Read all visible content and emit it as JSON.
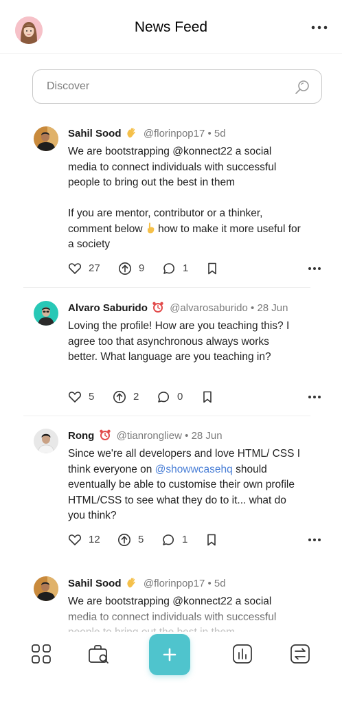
{
  "header": {
    "title": "News Feed"
  },
  "search": {
    "placeholder": "Discover"
  },
  "posts": [
    {
      "author": "Sahil Sood",
      "emoji": "waving-hand-icon",
      "handle": "@florinpop17",
      "time": "5d",
      "text_1": "We are bootstrapping @konnect22 a social media to connect individuals with successful people to bring out the best in them",
      "text_2a": "If you are mentor, contributor or a thinker, comment below",
      "text_2b": "how to make it more useful for a society",
      "likes": "27",
      "upvotes": "9",
      "comments": "1"
    },
    {
      "author": "Alvaro Saburido",
      "emoji": "alarm-clock-icon",
      "handle": "@alvarosaburido",
      "time": "28 Jun",
      "text_1": "Loving the profile! How are you teaching this? I agree too that asynchronous always works better. What language are you teaching in?",
      "likes": "5",
      "upvotes": "2",
      "comments": "0"
    },
    {
      "author": "Rong",
      "emoji": "alarm-clock-icon",
      "handle": "@tianrongliew",
      "time": "28 Jun",
      "text_1a": "Since we're all developers and love HTML/ CSS I think everyone on",
      "mention": "@showwcasehq",
      "text_1b": "should eventually be able to customise their own profile HTML/CSS to see what they do to it... what do you think?",
      "likes": "12",
      "upvotes": "5",
      "comments": "1"
    },
    {
      "author": "Sahil Sood",
      "emoji": "waving-hand-icon",
      "handle": "@florinpop17",
      "time": "5d",
      "text_1": "We are bootstrapping @konnect22 a social media to connect individuals with successful people to bring out the best in them"
    }
  ],
  "separator": "•",
  "colors": {
    "accent": "#4fc4cd",
    "mention": "#4a7fd6"
  }
}
